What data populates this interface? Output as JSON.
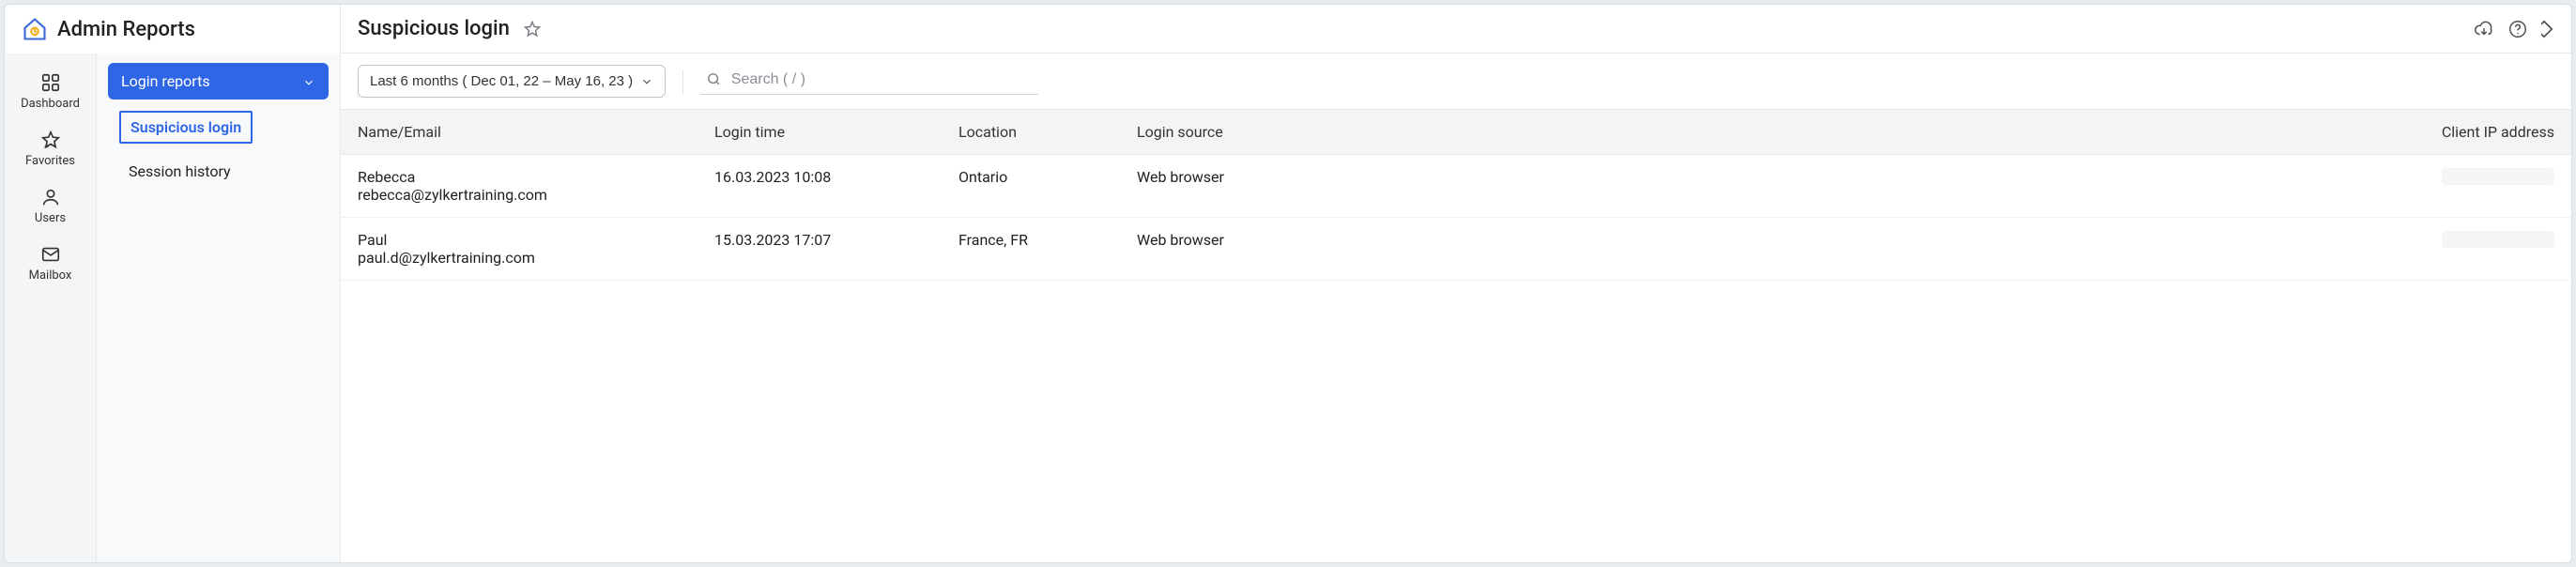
{
  "brand_title": "Admin Reports",
  "page_title": "Suspicious login",
  "rail": {
    "items": [
      {
        "label": "Dashboard"
      },
      {
        "label": "Favorites"
      },
      {
        "label": "Users"
      },
      {
        "label": "Mailbox"
      }
    ]
  },
  "subnav": {
    "group_label": "Login reports",
    "items": [
      {
        "label": "Suspicious login",
        "active": true
      },
      {
        "label": "Session history",
        "active": false
      }
    ]
  },
  "filters": {
    "date_range_label": "Last 6 months ( Dec 01, 22 – May 16, 23 )",
    "search_placeholder": "Search ( / )"
  },
  "table": {
    "columns": {
      "name": "Name/Email",
      "login_time": "Login time",
      "location": "Location",
      "login_source": "Login source",
      "client_ip": "Client IP address"
    },
    "rows": [
      {
        "name": "Rebecca",
        "email": "rebecca@zylkertraining.com",
        "login_time": "16.03.2023 10:08",
        "location": "Ontario",
        "login_source": "Web browser",
        "client_ip": ""
      },
      {
        "name": "Paul",
        "email": "paul.d@zylkertraining.com",
        "login_time": "15.03.2023 17:07",
        "location": "France, FR",
        "login_source": "Web browser",
        "client_ip": ""
      }
    ]
  }
}
